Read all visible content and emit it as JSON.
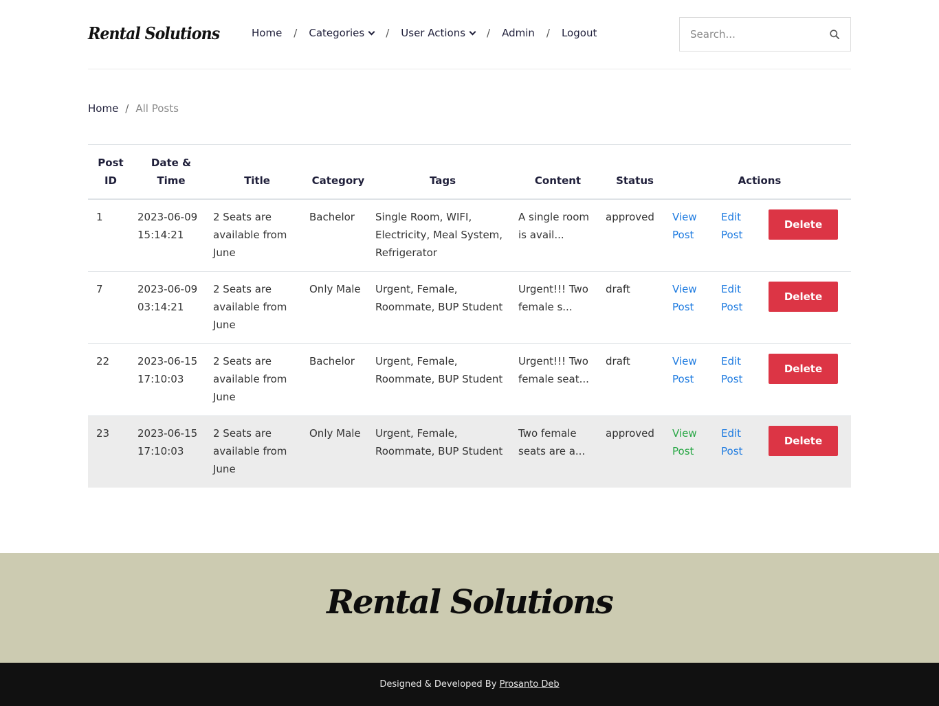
{
  "brand": {
    "logo": "Rental Solutions"
  },
  "nav": {
    "items": [
      {
        "label": "Home",
        "has_dropdown": false
      },
      {
        "label": "Categories",
        "has_dropdown": true
      },
      {
        "label": "User Actions",
        "has_dropdown": true
      },
      {
        "label": "Admin",
        "has_dropdown": false
      },
      {
        "label": "Logout",
        "has_dropdown": false
      }
    ],
    "separator": "/"
  },
  "search": {
    "placeholder": "Search...",
    "icon": "search-icon"
  },
  "breadcrumb": {
    "home": "Home",
    "separator": "/",
    "current": "All Posts"
  },
  "table": {
    "headers": {
      "post_id": "Post ID",
      "date_time": "Date & Time",
      "title": "Title",
      "category": "Category",
      "tags": "Tags",
      "content": "Content",
      "status": "Status",
      "actions": "Actions"
    },
    "view_label": "View Post",
    "edit_label": "Edit Post",
    "delete_label": "Delete",
    "rows": [
      {
        "id": "1",
        "date": "2023-06-09 15:14:21",
        "title": "2 Seats are available from June",
        "category": "Bachelor",
        "tags": "Single Room, WIFI, Electricity, Meal System, Refrigerator",
        "content": "A single room is avail...",
        "status": "approved"
      },
      {
        "id": "7",
        "date": "2023-06-09 03:14:21",
        "title": "2 Seats are available from June",
        "category": "Only Male",
        "tags": "Urgent, Female, Roommate, BUP Student",
        "content": "Urgent!!! Two female s...",
        "status": "draft"
      },
      {
        "id": "22",
        "date": "2023-06-15 17:10:03",
        "title": "2 Seats are available from June",
        "category": "Bachelor",
        "tags": "Urgent, Female, Roommate, BUP Student",
        "content": "Urgent!!! Two female seat...",
        "status": "draft"
      },
      {
        "id": "23",
        "date": "2023-06-15 17:10:03",
        "title": "2 Seats are available from June",
        "category": "Only Male",
        "tags": "Urgent, Female, Roommate, BUP Student",
        "content": "Two female seats are a...",
        "status": "approved"
      }
    ]
  },
  "footer": {
    "logo": "Rental Solutions",
    "credit_text": "Designed & Developed By",
    "credit_link": "Prosanto Deb"
  },
  "colors": {
    "delete_button": "#dc3545",
    "link": "#1e7be0",
    "link_visited_hover": "#28a745",
    "footer_top_bg": "#cccbb1",
    "footer_bottom_bg": "#111111"
  }
}
